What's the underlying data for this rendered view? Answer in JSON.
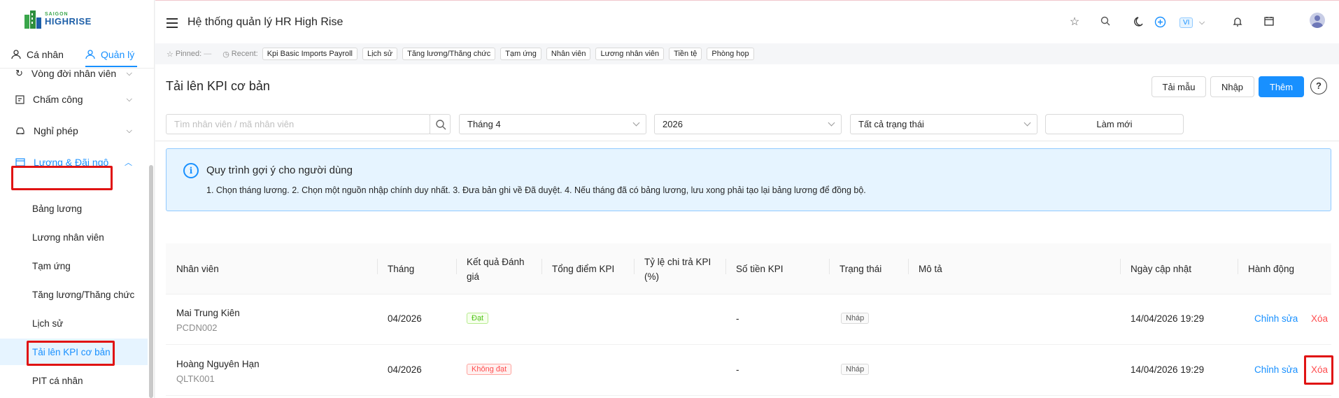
{
  "brand": {
    "small": "SAIGON",
    "big": "HIGHRISE"
  },
  "mode_tabs": {
    "personal": "Cá nhân",
    "manage": "Quản lý"
  },
  "sidebar": {
    "items": [
      {
        "label": "Vòng đời nhân viên"
      },
      {
        "label": "Chấm công"
      },
      {
        "label": "Nghỉ phép"
      },
      {
        "label": "Lương & Đãi ngộ"
      }
    ],
    "sub_items": [
      {
        "label": "Bảng lương"
      },
      {
        "label": "Lương nhân viên"
      },
      {
        "label": "Tạm ứng"
      },
      {
        "label": "Tăng lương/Thăng chức"
      },
      {
        "label": "Lịch sử"
      },
      {
        "label": "Tải lên KPI cơ bản"
      },
      {
        "label": "PIT cá nhân"
      }
    ]
  },
  "header": {
    "title": "Hệ thống quản lý HR High Rise",
    "lang": "VI"
  },
  "recent": {
    "pinned_label": "Pinned:",
    "pinned_value": "—",
    "recent_label": "Recent:",
    "chips": [
      "Kpi Basic Imports Payroll",
      "Lịch sử",
      "Tăng lương/Thăng chức",
      "Tạm ứng",
      "Nhân viên",
      "Lương nhân viên",
      "Tiền tệ",
      "Phòng họp"
    ]
  },
  "page": {
    "title": "Tải lên KPI cơ bản",
    "buttons": {
      "template": "Tải mẫu",
      "import": "Nhập",
      "add": "Thêm",
      "help": "?"
    }
  },
  "filters": {
    "search_placeholder": "Tìm nhân viên / mã nhân viên",
    "month": "Tháng 4",
    "year": "2026",
    "status": "Tất cả trạng thái",
    "refresh": "Làm mới"
  },
  "info": {
    "title": "Quy trình gợi ý cho người dùng",
    "body": "1. Chọn tháng lương. 2. Chọn một nguồn nhập chính duy nhất. 3. Đưa bản ghi về Đã duyệt. 4. Nếu tháng đã có bảng lương, lưu xong phải tạo lại bảng lương để đồng bộ."
  },
  "table": {
    "columns": {
      "employee": "Nhân viên",
      "month": "Tháng",
      "result": "Kết quả Đánh giá",
      "total_kpi": "Tổng điểm KPI",
      "pay_rate": "Tỷ lệ chi trả KPI (%)",
      "amount": "Số tiền KPI",
      "status": "Trạng thái",
      "description": "Mô tả",
      "updated": "Ngày cập nhật",
      "actions": "Hành động"
    },
    "rows": [
      {
        "name": "Mai Trung Kiên",
        "code": "PCDN002",
        "month": "04/2026",
        "result": "Đạt",
        "amount": "-",
        "status": "Nháp",
        "updated": "14/04/2026 19:29",
        "edit": "Chỉnh sửa",
        "delete": "Xóa"
      },
      {
        "name": "Hoàng Nguyên Hạn",
        "code": "QLTK001",
        "month": "04/2026",
        "result": "Không đạt",
        "amount": "-",
        "status": "Nháp",
        "updated": "14/04/2026 19:29",
        "edit": "Chỉnh sửa",
        "delete": "Xóa"
      }
    ]
  },
  "colors": {
    "primary": "#1890ff",
    "danger": "#ff4d4f",
    "success": "#52c41a",
    "highlight": "#e01313"
  }
}
